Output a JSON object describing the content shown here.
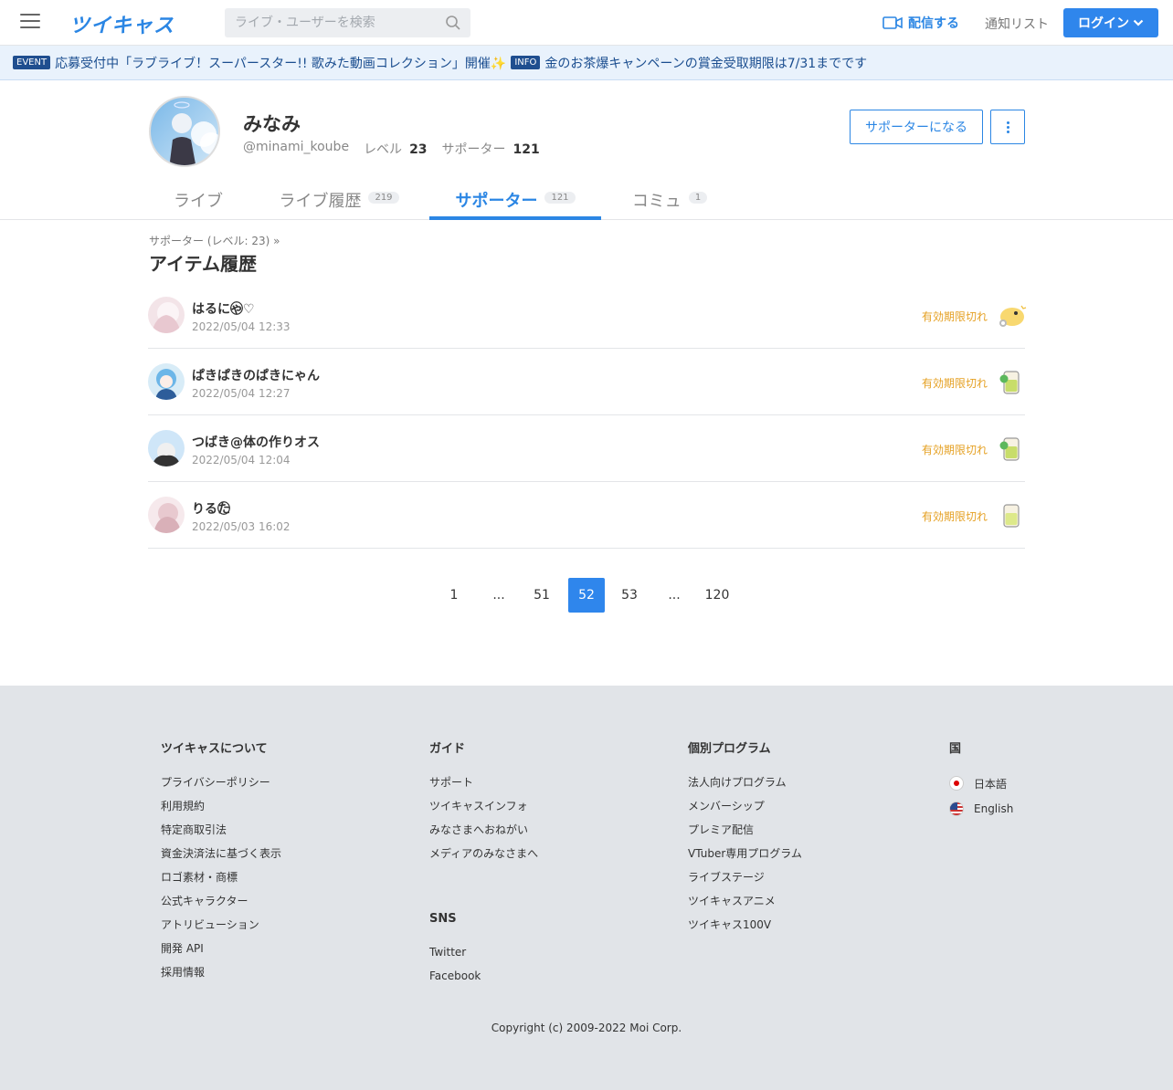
{
  "header": {
    "logo": "ツイキャス",
    "search_placeholder": "ライブ・ユーザーを検索",
    "broadcast_label": "配信する",
    "notify_label": "通知リスト",
    "login_label": "ログイン"
  },
  "banner": {
    "event_tag": "EVENT",
    "event_text": "応募受付中「ラブライブ！スーパースター!! 歌みた動画コレクション」開催✨",
    "info_tag": "INFO",
    "info_text": "金のお茶爆キャンペーンの賞金受取期限は7/31までです"
  },
  "profile": {
    "name": "みなみ",
    "handle": "@minami_koube",
    "level_label": "レベル",
    "level": "23",
    "supporter_label": "サポーター",
    "supporters": "121",
    "support_button": "サポーターになる"
  },
  "tabs": [
    {
      "label": "ライブ",
      "count": ""
    },
    {
      "label": "ライブ履歴",
      "count": "219"
    },
    {
      "label": "サポーター",
      "count": "121"
    },
    {
      "label": "コミュ",
      "count": "1"
    }
  ],
  "breadcrumb": "サポーター (レベル: 23)  »",
  "section_title": "アイテム履歴",
  "items": [
    {
      "name": "はるにゃ⃝⃝♡",
      "date": "2022/05/04 12:33",
      "status": "有効期限切れ"
    },
    {
      "name": "ぱきぱきのぱきにゃん",
      "date": "2022/05/04 12:27",
      "status": "有効期限切れ"
    },
    {
      "name": "つばき@体の作りオス",
      "date": "2022/05/04 12:04",
      "status": "有効期限切れ"
    },
    {
      "name": "りるた⃝⃝",
      "date": "2022/05/03 16:02",
      "status": "有効期限切れ"
    }
  ],
  "pagination": [
    "1",
    "...",
    "51",
    "52",
    "53",
    "...",
    "120"
  ],
  "current_page": "52",
  "footer": {
    "col1": {
      "title": "ツイキャスについて",
      "links": [
        "プライバシーポリシー",
        "利用規約",
        "特定商取引法",
        "資金決済法に基づく表示",
        "ロゴ素材・商標",
        "公式キャラクター",
        "アトリビューション",
        "開発 API",
        "採用情報"
      ]
    },
    "col2": {
      "title": "ガイド",
      "links": [
        "サポート",
        "ツイキャスインフォ",
        "みなさまへおねがい",
        "メディアのみなさまへ"
      ]
    },
    "col2b": {
      "title": "SNS",
      "links": [
        "Twitter",
        "Facebook"
      ]
    },
    "col3": {
      "title": "個別プログラム",
      "links": [
        "法人向けプログラム",
        "メンバーシップ",
        "プレミア配信",
        "VTuber専用プログラム",
        "ライブステージ",
        "ツイキャスアニメ",
        "ツイキャス100V"
      ]
    },
    "col4": {
      "title": "国",
      "langs": [
        "日本語",
        "English"
      ]
    },
    "copyright": "Copyright (c) 2009-2022 Moi Corp."
  },
  "colors": {
    "accent": "#2b86e4",
    "expired": "#e5a022",
    "footer_bg": "#e1e4e8"
  }
}
